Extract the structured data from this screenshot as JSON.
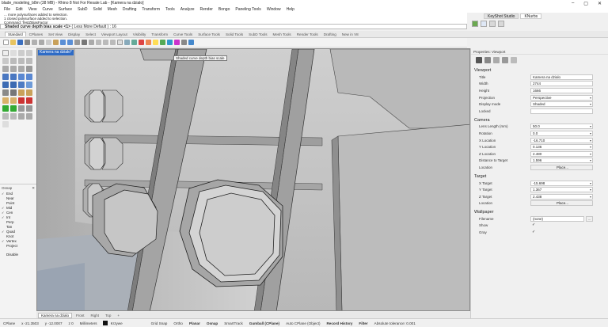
{
  "titlebar": {
    "title": "blade_modeling_b8m (38 MB) - Rhino 8 Not For Resale Lab - [Kamera na dzialo]"
  },
  "menu": [
    "File",
    "Edit",
    "View",
    "Curve",
    "Surface",
    "SubD",
    "Solid",
    "Mesh",
    "Drafting",
    "Transform",
    "Tools",
    "Analyze",
    "Render",
    "Bongo",
    "Paneling Tools",
    "Window",
    "Help"
  ],
  "command": {
    "history": [
      "... more polysurfaces added to selection.",
      "1 closed polysurface added to selection.",
      "Command: TestZBiasFactor"
    ],
    "prompt": "Shaded curve depth bias scale <1>",
    "options": "( Less  More  Default )",
    "value": ": 16"
  },
  "top_panel": {
    "tabs": [
      "KeyShot Studio",
      "KNurbs"
    ]
  },
  "toolbar_tabs": [
    "Standard",
    "CPlanes",
    "Set View",
    "Display",
    "Select",
    "Viewport Layout",
    "Visibility",
    "Transform",
    "Curve Tools",
    "Surface Tools",
    "Solid Tools",
    "SubD Tools",
    "Mesh Tools",
    "Render Tools",
    "Drafting",
    "New in V8"
  ],
  "viewport": {
    "title": "Kamera na dzialo*",
    "tooltip": "Shaded curve depth bias scale"
  },
  "viewport_tabs": [
    "Kamera na dzialo",
    "Front",
    "Right",
    "Top",
    "+"
  ],
  "osnap": {
    "title": "Osnap",
    "items": [
      {
        "label": "End",
        "checked": true
      },
      {
        "label": "Near",
        "checked": false
      },
      {
        "label": "Point",
        "checked": false
      },
      {
        "label": "Mid",
        "checked": true
      },
      {
        "label": "Cen",
        "checked": true
      },
      {
        "label": "Int",
        "checked": true
      },
      {
        "label": "Perp",
        "checked": false
      },
      {
        "label": "Tan",
        "checked": false
      },
      {
        "label": "Quad",
        "checked": true
      },
      {
        "label": "Knot",
        "checked": false
      },
      {
        "label": "Vertex",
        "checked": true
      },
      {
        "label": "Project",
        "checked": false
      },
      {
        "label": "",
        "checked": false
      },
      {
        "label": "Disable",
        "checked": false
      }
    ]
  },
  "properties": {
    "header": "Properties: Viewport",
    "viewport": {
      "section": "Viewport",
      "rows": [
        {
          "label": "Title",
          "value": "Kamera na dzialo",
          "kind": "text"
        },
        {
          "label": "Width",
          "value": "2744",
          "kind": "text"
        },
        {
          "label": "Height",
          "value": "1666",
          "kind": "text"
        },
        {
          "label": "Projection",
          "value": "Perspective",
          "kind": "dd"
        },
        {
          "label": "Display mode",
          "value": "Shaded",
          "kind": "dd"
        },
        {
          "label": "Locked",
          "value": "",
          "kind": "text"
        }
      ]
    },
    "camera": {
      "section": "Camera",
      "rows": [
        {
          "label": "Lens Length (mm)",
          "value": "50.0",
          "kind": "dd"
        },
        {
          "label": "Rotation",
          "value": "0.0",
          "kind": "dd"
        },
        {
          "label": "X Location",
          "value": "-16.710",
          "kind": "dd"
        },
        {
          "label": "Y Location",
          "value": "0.136",
          "kind": "dd"
        },
        {
          "label": "Z Location",
          "value": "2.480",
          "kind": "dd"
        },
        {
          "label": "Distance to Target",
          "value": "1.596",
          "kind": "dd"
        },
        {
          "label": "Location",
          "value": "Place...",
          "kind": "btn"
        }
      ]
    },
    "target": {
      "section": "Target",
      "rows": [
        {
          "label": "X Target",
          "value": "-15.698",
          "kind": "dd"
        },
        {
          "label": "Y Target",
          "value": "1.367",
          "kind": "dd"
        },
        {
          "label": "Z Target",
          "value": "2.438",
          "kind": "dd"
        },
        {
          "label": "Location",
          "value": "Place...",
          "kind": "btn"
        }
      ]
    },
    "wallpaper": {
      "section": "Wallpaper",
      "rows": [
        {
          "label": "Filename",
          "value": "(none)",
          "kind": "file",
          "extra": "..."
        },
        {
          "label": "Show",
          "value": "✓",
          "kind": "chk"
        },
        {
          "label": "Gray",
          "value": "✓",
          "kind": "chk"
        }
      ]
    }
  },
  "status": {
    "cplane": "CPlane",
    "x": "x -21.3503",
    "y": "y -12.0007",
    "z": "z 0",
    "units": "Millimeters",
    "layer": "Krzywe",
    "toggles": [
      "Grid Snap",
      "Ortho",
      "Planar",
      "Osnap",
      "SmartTrack",
      "Gumball (CPlane)",
      "Auto CPlane (Object)",
      "Record History",
      "Filter"
    ],
    "tolerance": "Absolute tolerance: 0.001"
  }
}
